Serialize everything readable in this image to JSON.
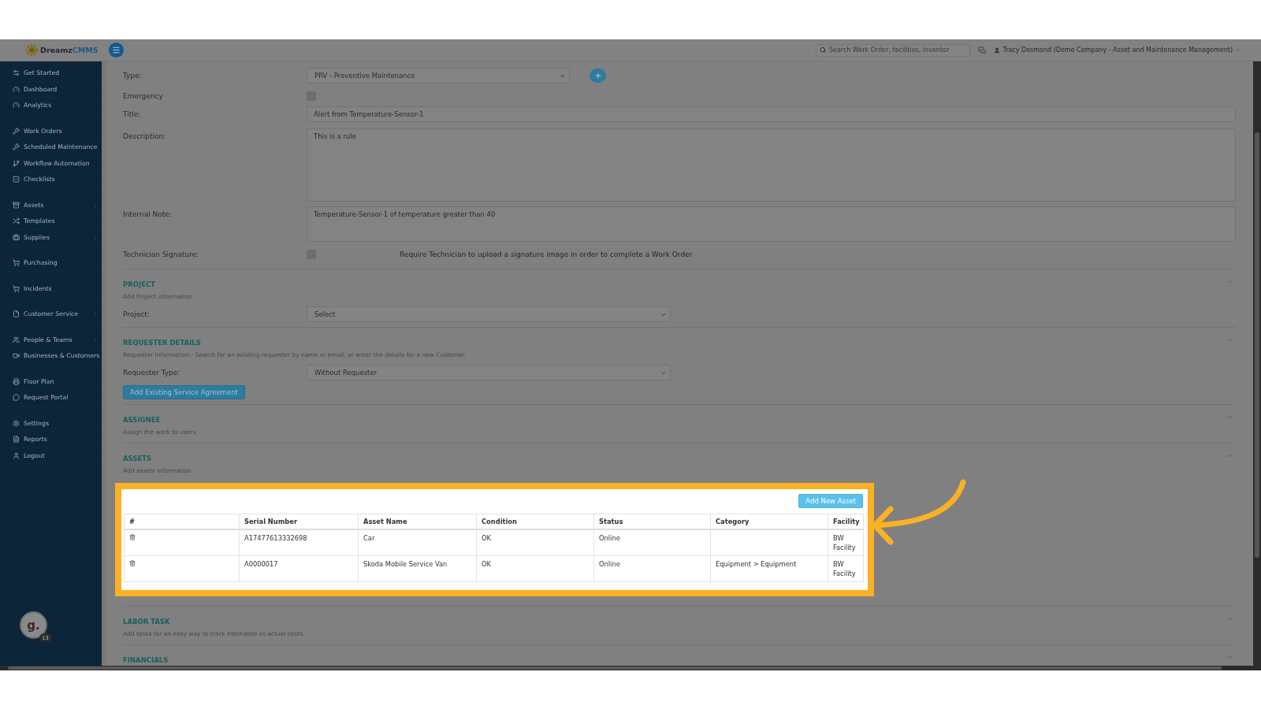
{
  "header": {
    "logo": [
      "Dreamz",
      "CMMS"
    ],
    "search": {
      "placeholder": "Search Work Order, facilities, inventor"
    },
    "user": "Tracy Desmond (Demo Company - Asset and Maintenance Management)"
  },
  "sidebar": {
    "groups": [
      {
        "items": [
          {
            "label": "Get Started",
            "has_submenu": false
          },
          {
            "label": "Dashboard",
            "has_submenu": false
          },
          {
            "label": "Analytics",
            "has_submenu": false
          }
        ]
      },
      {
        "items": [
          {
            "label": "Work Orders",
            "has_submenu": false
          },
          {
            "label": "Scheduled Maintenance",
            "has_submenu": false
          },
          {
            "label": "Workflow Automation",
            "has_submenu": false
          },
          {
            "label": "Checklists",
            "has_submenu": false
          }
        ]
      },
      {
        "items": [
          {
            "label": "Assets",
            "has_submenu": true
          },
          {
            "label": "Templates",
            "has_submenu": false
          },
          {
            "label": "Supplies",
            "has_submenu": true
          }
        ]
      },
      {
        "items": [
          {
            "label": "Purchasing",
            "has_submenu": false
          }
        ]
      },
      {
        "items": [
          {
            "label": "Incidents",
            "has_submenu": false
          }
        ]
      },
      {
        "items": [
          {
            "label": "Customer Service",
            "has_submenu": true
          }
        ]
      },
      {
        "items": [
          {
            "label": "People & Teams",
            "has_submenu": true
          },
          {
            "label": "Businesses & Customers",
            "has_submenu": false
          }
        ]
      },
      {
        "items": [
          {
            "label": "Floor Plan",
            "has_submenu": false
          },
          {
            "label": "Request Portal",
            "has_submenu": false
          }
        ]
      },
      {
        "items": [
          {
            "label": "Settings",
            "has_submenu": false
          },
          {
            "label": "Reports",
            "has_submenu": false
          },
          {
            "label": "Logout",
            "has_submenu": false
          }
        ]
      }
    ],
    "avatar": {
      "initial": "g.",
      "badge": "13"
    }
  },
  "form": {
    "type": {
      "label": "Type:",
      "value": "PRV - Preventive Maintenance"
    },
    "emergency": {
      "label": "Emergency",
      "checked": false
    },
    "title": {
      "label": "Title:",
      "value": "Alert from Temperature-Sensor-1"
    },
    "description": {
      "label": "Description:",
      "value": "This is a rule"
    },
    "internal_note": {
      "label": "Internal Note:",
      "value": "Temperature-Sensor-1 of temperature greater than 40"
    },
    "technician_signature": {
      "label": "Technician Signature:",
      "checked": false,
      "hint": "Require Technician to upload a signature image in order to complete a Work Order"
    }
  },
  "sections": [
    {
      "title": "PROJECT",
      "subtitle": "Add Project information",
      "expanded": true,
      "field": {
        "label": "Project:",
        "value": "Select"
      }
    },
    {
      "title": "REQUESTER DETAILS",
      "subtitle": "Requester Information - Search for an existing requester by name or email, or enter the details for a new Customer.",
      "expanded": true,
      "field": {
        "label": "Requester Type:",
        "value": "Without Requester"
      },
      "agreement_button": "Add Existing Service Agreement"
    },
    {
      "title": "ASSIGNEE",
      "subtitle": "Assign the work to users.",
      "expanded": false
    },
    {
      "title": "ASSETS",
      "subtitle": "Add assets information",
      "expanded": true,
      "add_button": "Add New Asset",
      "columns": [
        "#",
        "Serial Number",
        "Asset Name",
        "Condition",
        "Status",
        "Category",
        "Facility"
      ],
      "rows": [
        {
          "serial_number": "A17477613332698",
          "asset_name": "Car",
          "condition": "OK",
          "status": "Online",
          "facility": "BW Facility"
        },
        {
          "serial_number": "A0000017",
          "asset_name": "Skoda Mobile Service Van",
          "condition": "OK",
          "status": "Online",
          "category": "Equipment > Equipment",
          "facility": "BW Facility"
        }
      ]
    },
    {
      "title": "LABOR TASK",
      "subtitle": "Add tasks for an easy way to track estimated vs actual costs.",
      "expanded": false
    },
    {
      "title": "FINANCIALS",
      "expanded": false
    }
  ]
}
